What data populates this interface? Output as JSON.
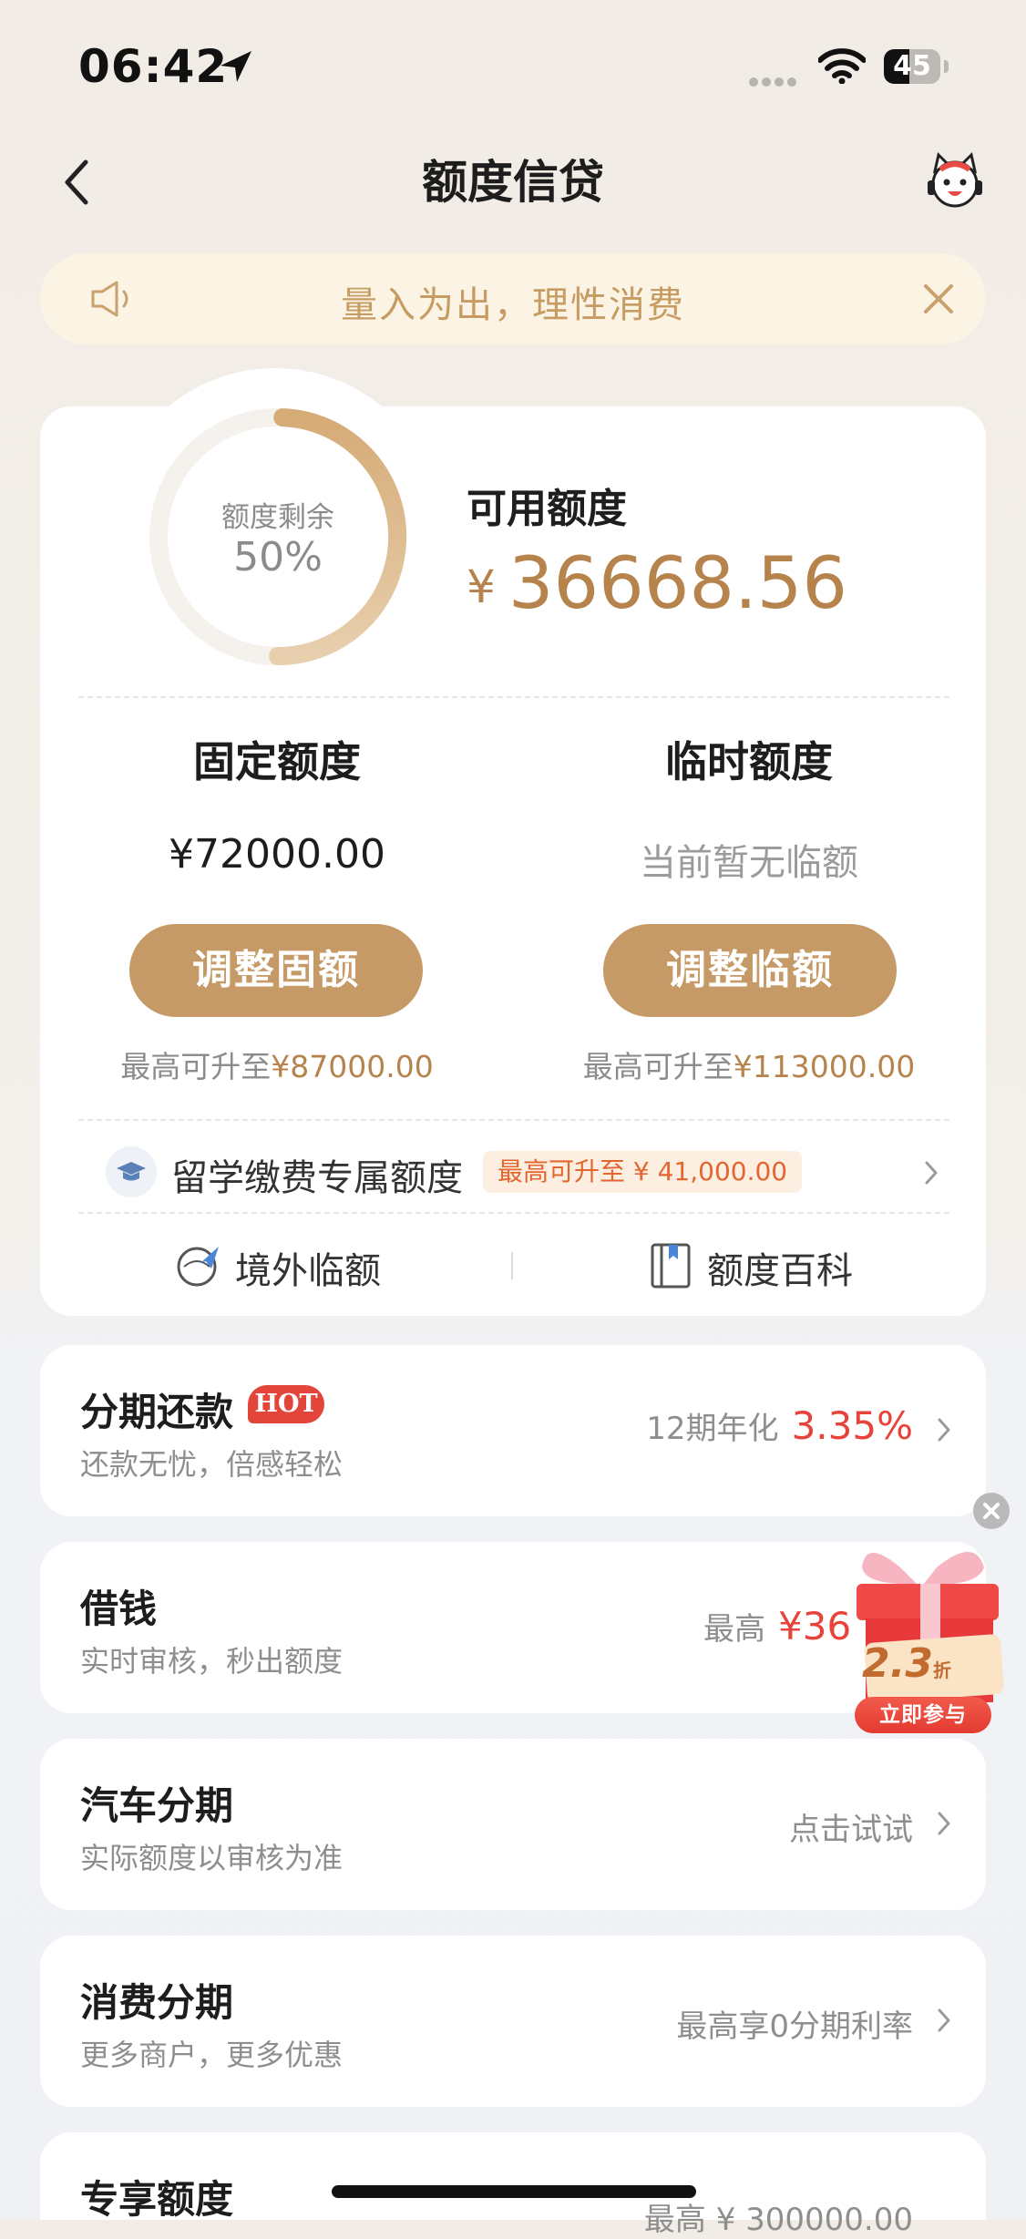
{
  "status_bar": {
    "time": "06:42",
    "battery": "45",
    "battery_level": 0.45
  },
  "nav": {
    "title": "额度信贷"
  },
  "notice": {
    "text": "量入为出，理性消费"
  },
  "credit": {
    "ring_label": "额度剩余",
    "ring_value": "50%",
    "remaining_fraction": 0.5,
    "available_label": "可用额度",
    "currency": "¥",
    "available_amount": "36668.56"
  },
  "fixed": {
    "title": "固定额度",
    "value": "¥72000.00",
    "button": "调整固额",
    "note_prefix": "最高可升至",
    "note_amount": "¥87000.00"
  },
  "temp": {
    "title": "临时额度",
    "value": "当前暂无临额",
    "button": "调整临额",
    "note_prefix": "最高可升至",
    "note_amount": "¥113000.00"
  },
  "study": {
    "label": "留学缴费专属额度",
    "badge": "最高可升至 ¥ 41,000.00"
  },
  "links": {
    "overseas": "境外临额",
    "wiki": "额度百科"
  },
  "list": [
    {
      "title": "分期还款",
      "badge": "HOT",
      "subtitle": "还款无忧，倍感轻松",
      "right_text": "12期年化",
      "right_highlight": "3.35%"
    },
    {
      "title": "借钱",
      "subtitle": "实时审核，秒出额度",
      "right_text": "最高",
      "right_highlight": "¥36"
    },
    {
      "title": "汽车分期",
      "subtitle": "实际额度以审核为准",
      "right_text": "点击试试"
    },
    {
      "title": "消费分期",
      "subtitle": "更多商户，更多优惠",
      "right_text": "最高享0分期利率"
    },
    {
      "title": "专享额度",
      "right_text": "最高 ¥ 300000.00"
    }
  ],
  "gift": {
    "discount": "2.3",
    "discount_unit": "折",
    "button": "立即参与"
  },
  "colors": {
    "gold": "#c59a66",
    "gold_text": "#b7834d",
    "red": "#e8433a",
    "notice_bg": "#fbf3e3"
  }
}
